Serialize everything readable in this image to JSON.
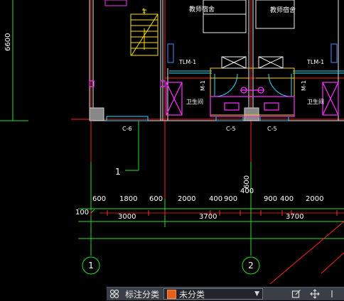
{
  "drawing": {
    "room_labels": {
      "top_left": "教师宿舍",
      "top_right": "教师宿舍",
      "bathroom_left": "卫生间",
      "bathroom_right": "卫生间"
    },
    "window_tags": {
      "tlm_left": "TLM-1",
      "tlm_right": "TLM-1",
      "m1_left": "M-1",
      "m1_right": "M-1",
      "c6": "C-6",
      "c5_left": "C-5",
      "c5_right": "C-5"
    },
    "left_dimension": "6600",
    "stair_marker": "1",
    "section_marker": "1",
    "elevation_label": "100",
    "dim_row1": [
      "600",
      "1800",
      "600",
      "2000",
      "400",
      "900",
      "900",
      "400",
      "2000"
    ],
    "dim_mid_top": "600",
    "dim_mid_low": "400",
    "dim_row2": [
      "3000",
      "3700",
      "3700"
    ],
    "axis_markers": [
      "1",
      "2"
    ]
  },
  "toolbar": {
    "label": "标注分类",
    "select_value": "未分类",
    "icons": [
      "category-icon",
      "edit-icon",
      "move-icon"
    ]
  }
}
